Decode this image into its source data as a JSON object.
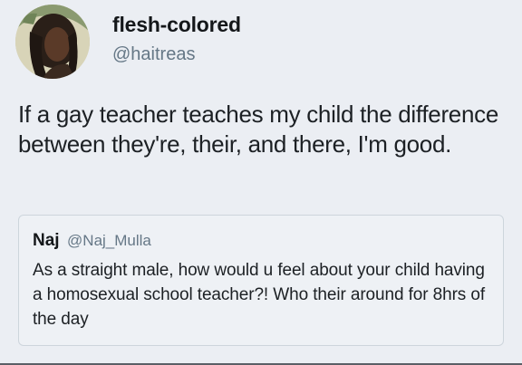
{
  "tweet": {
    "display_name": "flesh-colored",
    "handle": "@haitreas",
    "text": "If a gay teacher teaches my child the difference between they're, their, and there, I'm good."
  },
  "quoted_tweet": {
    "display_name": "Naj",
    "handle": "@Naj_Mulla",
    "text": "As a straight male, how would u feel about your child having a homosexual school teacher?! Who their around for 8hrs of the day"
  }
}
